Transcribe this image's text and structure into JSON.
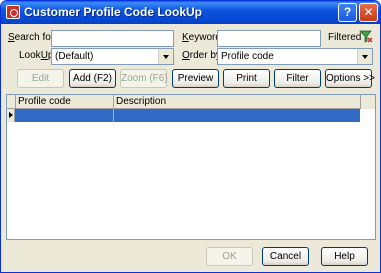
{
  "window": {
    "title": "Customer Profile Code LookUp",
    "help_symbol": "?",
    "close_symbol": "✕"
  },
  "search": {
    "search_for_label": "Search for",
    "search_for_value": "",
    "keyword_label": "Keyword",
    "keyword_value": "",
    "filtered_label": "Filtered",
    "lookup_label": "LookUp",
    "lookup_value": "(Default)",
    "order_by_label": "Order by",
    "order_by_value": "Profile code"
  },
  "toolbar": {
    "edit": "Edit",
    "add": "Add (F2)",
    "zoom": "Zoom (F6)",
    "preview": "Preview",
    "print": "Print",
    "filter": "Filter",
    "options": "Options >>"
  },
  "grid": {
    "columns": [
      "Profile code",
      "Description"
    ]
  },
  "footer": {
    "ok": "OK",
    "cancel": "Cancel",
    "help": "Help"
  },
  "colors": {
    "title_bar": "#0b55e0",
    "selection": "#316ac5",
    "dialog_bg": "#ece9d8"
  }
}
